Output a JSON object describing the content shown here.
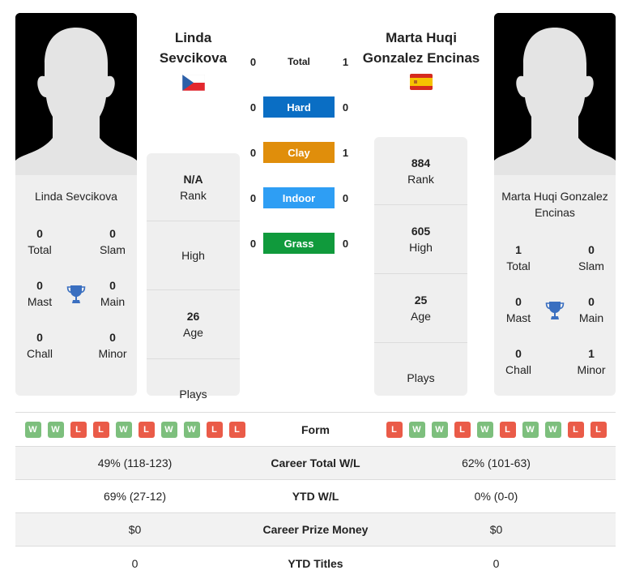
{
  "player1": {
    "name": "Linda Sevcikova",
    "name_head_line1": "Linda",
    "name_head_line2": "Sevcikova",
    "flag": "czech-republic-flag",
    "titles": {
      "total": "0",
      "total_label": "Total",
      "slam": "0",
      "slam_label": "Slam",
      "mast": "0",
      "mast_label": "Mast",
      "main": "0",
      "main_label": "Main",
      "chall": "0",
      "chall_label": "Chall",
      "minor": "0",
      "minor_label": "Minor"
    },
    "stats": {
      "rank": "N/A",
      "rank_label": "Rank",
      "high": "",
      "high_label": "High",
      "age": "26",
      "age_label": "Age",
      "plays": "",
      "plays_label": "Plays"
    },
    "form": [
      "W",
      "W",
      "L",
      "L",
      "W",
      "L",
      "W",
      "W",
      "L",
      "L"
    ]
  },
  "player2": {
    "name": "Marta Huqi Gonzalez Encinas",
    "name_head_line1": "Marta Huqi",
    "name_head_line2": "Gonzalez Encinas",
    "flag": "spain-flag",
    "titles": {
      "total": "1",
      "total_label": "Total",
      "slam": "0",
      "slam_label": "Slam",
      "mast": "0",
      "mast_label": "Mast",
      "main": "0",
      "main_label": "Main",
      "chall": "0",
      "chall_label": "Chall",
      "minor": "1",
      "minor_label": "Minor"
    },
    "stats": {
      "rank": "884",
      "rank_label": "Rank",
      "high": "605",
      "high_label": "High",
      "age": "25",
      "age_label": "Age",
      "plays": "",
      "plays_label": "Plays"
    },
    "form": [
      "L",
      "W",
      "W",
      "L",
      "W",
      "L",
      "W",
      "W",
      "L",
      "L"
    ]
  },
  "h2h": [
    {
      "label": "Total",
      "p1": "0",
      "p2": "1",
      "color": ""
    },
    {
      "label": "Hard",
      "p1": "0",
      "p2": "0",
      "color": "#0a6ec4"
    },
    {
      "label": "Clay",
      "p1": "0",
      "p2": "1",
      "color": "#e08e0b"
    },
    {
      "label": "Indoor",
      "p1": "0",
      "p2": "0",
      "color": "#2e9ef4"
    },
    {
      "label": "Grass",
      "p1": "0",
      "p2": "0",
      "color": "#109a3c"
    }
  ],
  "comparison": {
    "form_label": "Form",
    "rows": [
      {
        "label": "Career Total W/L",
        "p1": "49% (118-123)",
        "p2": "62% (101-63)"
      },
      {
        "label": "YTD W/L",
        "p1": "69% (27-12)",
        "p2": "0% (0-0)"
      },
      {
        "label": "Career Prize Money",
        "p1": "$0",
        "p2": "$0"
      },
      {
        "label": "YTD Titles",
        "p1": "0",
        "p2": "0"
      }
    ]
  },
  "colors": {
    "win": "#7dbf7d",
    "loss": "#ea5b48",
    "trophy": "#3a6fc0"
  }
}
